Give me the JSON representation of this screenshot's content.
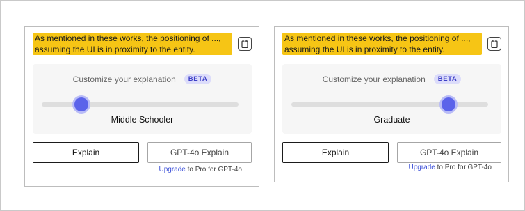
{
  "panels": [
    {
      "quote": "As mentioned in these works, the positioning of ..., assuming the UI is in proximity to the entity.",
      "customize_label": "Customize your explanation",
      "badge": "BETA",
      "level_value": 0.2,
      "level_label": "Middle Schooler",
      "explain_label": "Explain",
      "gpt_label": "GPT-4o Explain",
      "upgrade_link": "Upgrade",
      "upgrade_rest": "to Pro for GPT-4o"
    },
    {
      "quote": "As mentioned in these works, the positioning of ..., assuming the UI is in proximity to the entity.",
      "customize_label": "Customize your explanation",
      "badge": "BETA",
      "level_value": 0.8,
      "level_label": "Graduate",
      "explain_label": "Explain",
      "gpt_label": "GPT-4o Explain",
      "upgrade_link": "Upgrade",
      "upgrade_rest": "to Pro for GPT-4o"
    }
  ],
  "colors": {
    "highlight": "#f6c515",
    "accent": "#5b63ea",
    "beta_bg": "#dcdcfa",
    "link": "#3b4fd8"
  },
  "icons": {
    "copy": "clipboard-icon"
  }
}
